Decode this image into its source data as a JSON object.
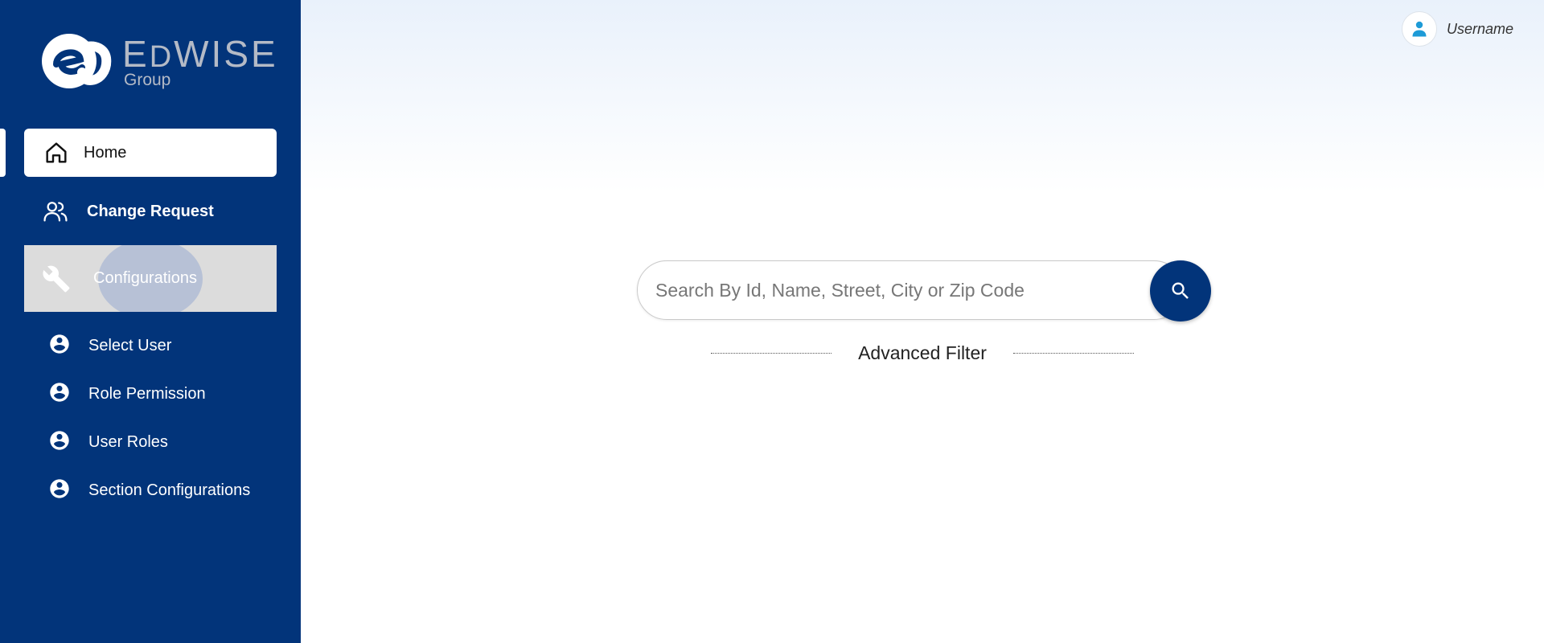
{
  "brand": {
    "name_first": "E",
    "name_d": "D",
    "name_rest": "WISE",
    "sub": "Group"
  },
  "sidebar": {
    "home": {
      "label": "Home",
      "icon": "home-icon"
    },
    "change_request": {
      "label": "Change Request",
      "icon": "users-icon"
    },
    "configurations": {
      "label": "Configurations",
      "icon": "wrench-icon"
    },
    "sub_items": [
      {
        "label": "Select User",
        "icon": "account-circle-icon"
      },
      {
        "label": "Role Permission",
        "icon": "account-circle-icon"
      },
      {
        "label": "User Roles",
        "icon": "account-circle-icon"
      },
      {
        "label": "Section Configurations",
        "icon": "account-circle-icon"
      }
    ]
  },
  "header": {
    "username": "Username"
  },
  "search": {
    "placeholder": "Search By Id, Name, Street, City or Zip Code",
    "value": ""
  },
  "advanced_filter": {
    "label": "Advanced Filter"
  },
  "colors": {
    "sidebar_bg": "#02347a",
    "accent": "#02347a",
    "avatar_icon": "#1e9bd7",
    "config_active_bg": "#dcdcdc"
  }
}
